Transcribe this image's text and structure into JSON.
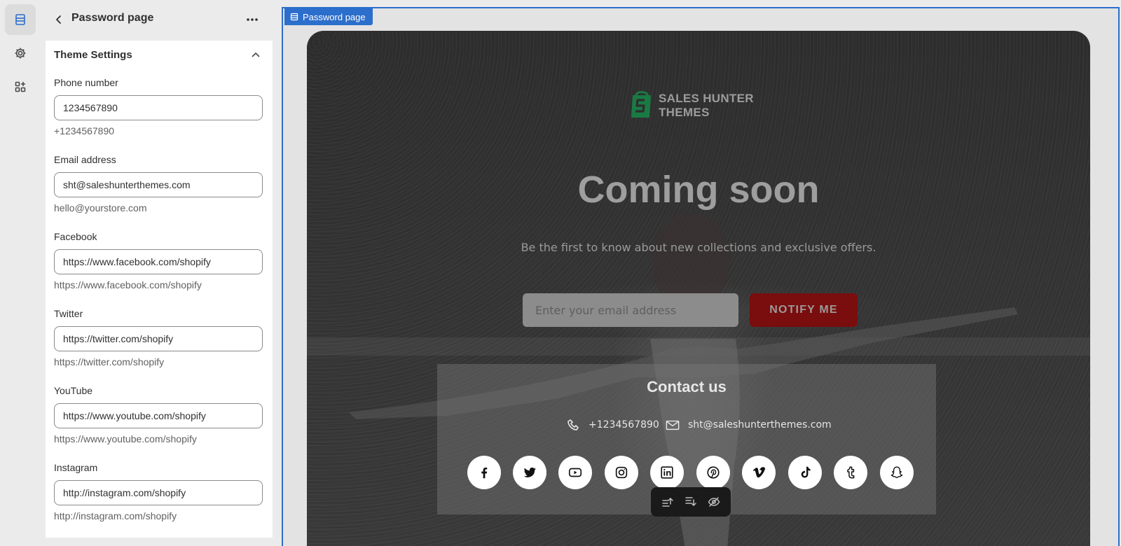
{
  "sidebar": {
    "title": "Password page",
    "panel_title": "Theme Settings",
    "fields": [
      {
        "label": "Phone number",
        "value": "1234567890",
        "hint": "+1234567890"
      },
      {
        "label": "Email address",
        "value": "sht@saleshunterthemes.com",
        "hint": "hello@yourstore.com"
      },
      {
        "label": "Facebook",
        "value": "https://www.facebook.com/shopify",
        "hint": "https://www.facebook.com/shopify"
      },
      {
        "label": "Twitter",
        "value": "https://twitter.com/shopify",
        "hint": "https://twitter.com/shopify"
      },
      {
        "label": "YouTube",
        "value": "https://www.youtube.com/shopify",
        "hint": "https://www.youtube.com/shopify"
      },
      {
        "label": "Instagram",
        "value": "http://instagram.com/shopify",
        "hint": "http://instagram.com/shopify"
      }
    ]
  },
  "rail": {
    "icons": [
      "sections-icon",
      "gear-icon",
      "apps-icon"
    ]
  },
  "preview": {
    "tag": "Password page",
    "logo": {
      "line1": "SALES HUNTER",
      "line2": "THEMES",
      "color": "#1a8a4c"
    },
    "title": "Coming soon",
    "subtitle": "Be the first to know about new collections and exclusive offers.",
    "email_placeholder": "Enter your email address",
    "notify_label": "NOTIFY ME",
    "notify_color": "#c41414",
    "contact": {
      "title": "Contact us",
      "phone": "+1234567890",
      "email": "sht@saleshunterthemes.com"
    },
    "socials": [
      "facebook-icon",
      "twitter-icon",
      "youtube-icon",
      "instagram-icon",
      "linkedin-icon",
      "pinterest-icon",
      "vimeo-icon",
      "tiktok-icon",
      "tumblr-icon",
      "snapchat-icon"
    ]
  },
  "colors": {
    "accent": "#2c6ecb"
  }
}
